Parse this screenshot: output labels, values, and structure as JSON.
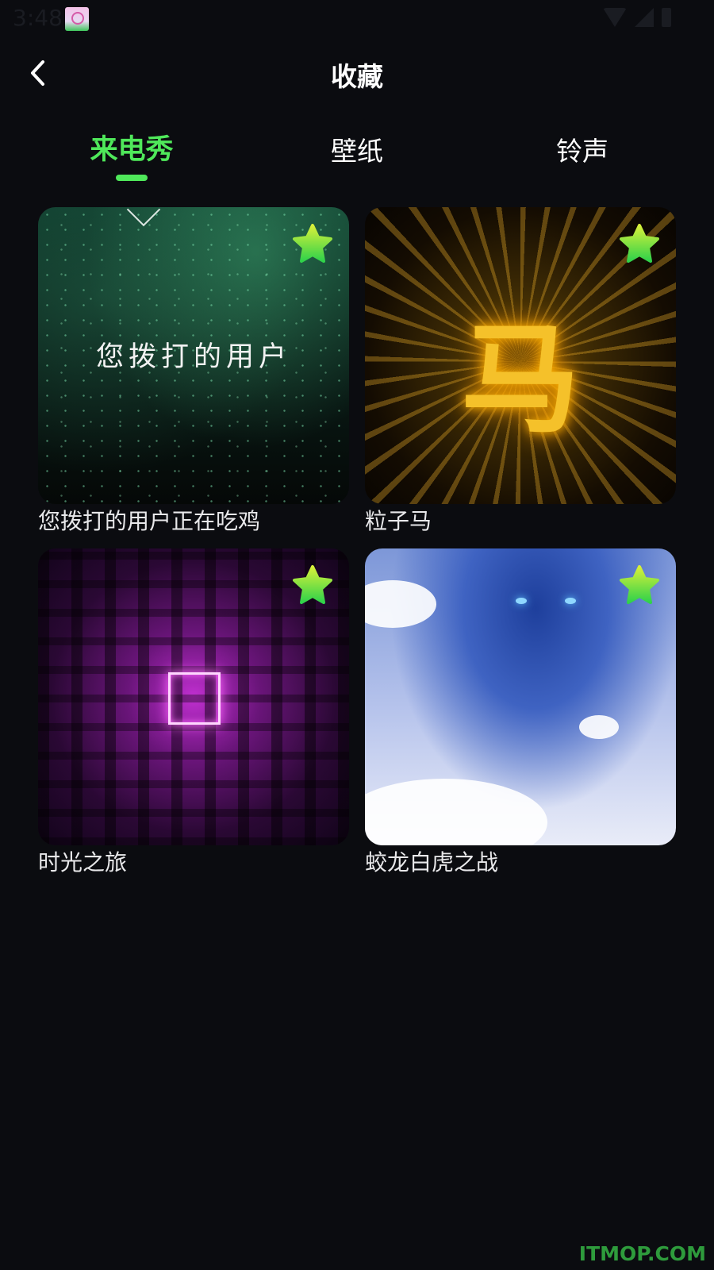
{
  "status_bar": {
    "time": "3:48",
    "app_icon": "app-icon",
    "icons": [
      "wifi-icon",
      "signal-icon",
      "battery-icon"
    ]
  },
  "header": {
    "title": "收藏",
    "back_icon": "chevron-left-icon"
  },
  "tabs": [
    {
      "label": "来电秀",
      "active": true
    },
    {
      "label": "壁纸",
      "active": false
    },
    {
      "label": "铃声",
      "active": false
    }
  ],
  "colors": {
    "accent": "#4fe85a",
    "background": "#0b0c10",
    "watermark": "#2e9b3c"
  },
  "items": [
    {
      "title": "您拨打的用户正在吃鸡",
      "overlay_text": "您拨打的用户",
      "favorited": true,
      "fav_icon": "star-icon"
    },
    {
      "title": "粒子马",
      "overlay_text": "马",
      "favorited": true,
      "fav_icon": "star-icon"
    },
    {
      "title": "时光之旅",
      "favorited": true,
      "fav_icon": "star-icon"
    },
    {
      "title": "蛟龙白虎之战",
      "favorited": true,
      "fav_icon": "star-icon"
    }
  ],
  "watermark": "ITMOP.COM"
}
